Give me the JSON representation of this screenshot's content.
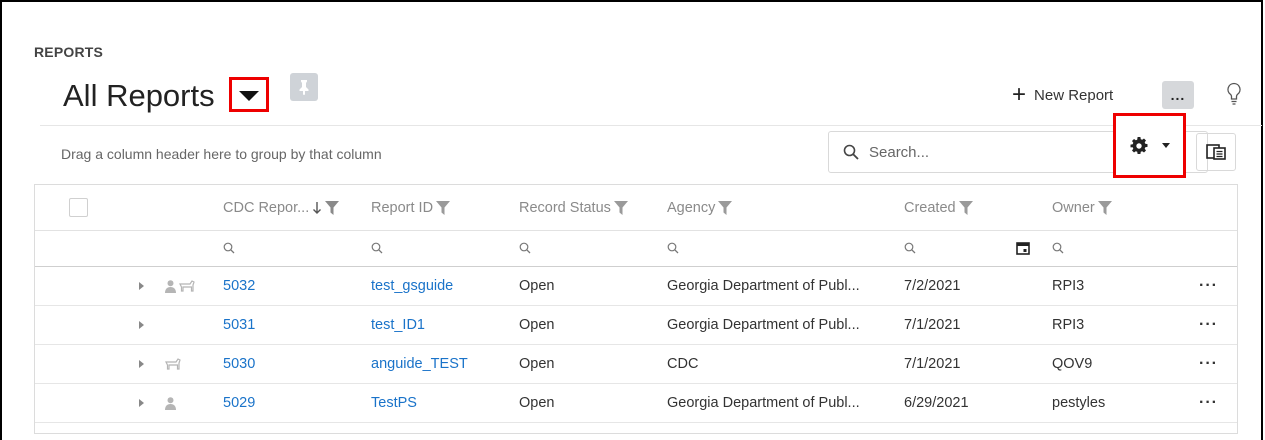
{
  "header": {
    "section_label": "REPORTS",
    "title": "All Reports",
    "new_report_label": "New Report",
    "more_label": "..."
  },
  "toolbar": {
    "group_hint": "Drag a column header here to group by that column",
    "search_placeholder": "Search..."
  },
  "grid": {
    "columns": [
      "CDC Repor...",
      "Report ID",
      "Record Status",
      "Agency",
      "Created",
      "Owner"
    ],
    "sorted_column": "CDC Repor...",
    "sort_direction": "descending",
    "rows": [
      {
        "cdc": "5032",
        "report_id": "test_gsguide",
        "status": "Open",
        "agency": "Georgia Department of Publ...",
        "created": "7/2/2021",
        "owner": "RPI3",
        "user_icon": true,
        "animal_icon": true
      },
      {
        "cdc": "5031",
        "report_id": "test_ID1",
        "status": "Open",
        "agency": "Georgia Department of Publ...",
        "created": "7/1/2021",
        "owner": "RPI3",
        "user_icon": false,
        "animal_icon": false
      },
      {
        "cdc": "5030",
        "report_id": "anguide_TEST",
        "status": "Open",
        "agency": "CDC",
        "created": "7/1/2021",
        "owner": "QOV9",
        "user_icon": false,
        "animal_icon": true
      },
      {
        "cdc": "5029",
        "report_id": "TestPS",
        "status": "Open",
        "agency": "Georgia Department of Publ...",
        "created": "6/29/2021",
        "owner": "pestyles",
        "user_icon": true,
        "animal_icon": false
      }
    ],
    "row_menu_label": "···"
  },
  "colors": {
    "link": "#1a73c9",
    "highlight": "#e00000"
  }
}
